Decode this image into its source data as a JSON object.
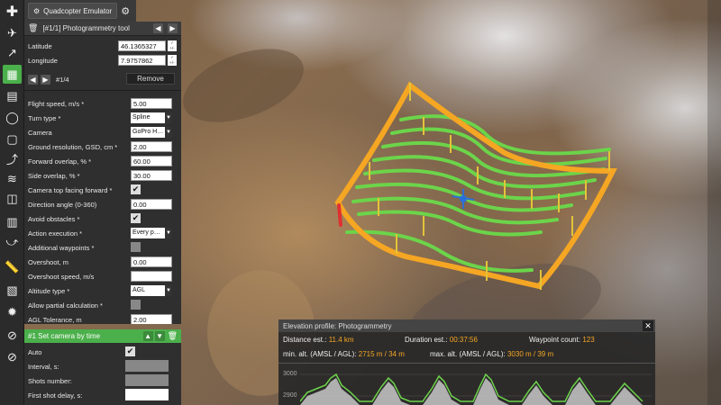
{
  "emulator": {
    "label": "Quadcopter Emulator"
  },
  "panel": {
    "title": "[#1/1] Photogrammetry tool",
    "latitude_label": "Latitude",
    "latitude": "46.1365327",
    "longitude_label": "Longitude",
    "longitude": "7.9757862",
    "nav_label": "#1/4",
    "remove_label": "Remove",
    "fields": [
      {
        "label": "Flight speed, m/s *",
        "value": "5.00"
      },
      {
        "label": "Turn type *",
        "value": "Spline"
      },
      {
        "label": "Camera",
        "value": "GoPro H…"
      },
      {
        "label": "Ground resolution, GSD, cm *",
        "value": "2.00"
      },
      {
        "label": "Forward overlap, % *",
        "value": "60.00"
      },
      {
        "label": "Side overlap, % *",
        "value": "30.00"
      },
      {
        "label": "Camera top facing forward *",
        "value": "✔"
      },
      {
        "label": "Direction angle (0-360)",
        "value": "0.00"
      },
      {
        "label": "Avoid obstacles *",
        "value": "✔"
      },
      {
        "label": "Action execution *",
        "value": "Every p…"
      },
      {
        "label": "Additional waypoints *",
        "value": ""
      },
      {
        "label": "Overshoot, m",
        "value": "0.00"
      },
      {
        "label": "Overshoot speed, m/s",
        "value": ""
      },
      {
        "label": "Altitude type *",
        "value": "AGL"
      },
      {
        "label": "Allow partial calculation *",
        "value": ""
      },
      {
        "label": "AGL Tolerance, m",
        "value": "2.00"
      }
    ]
  },
  "action": {
    "title": "#1 Set camera by time",
    "auto_label": "Auto",
    "auto_value": "✔",
    "interval_label": "Interval, s:",
    "shots_label": "Shots number:",
    "delay_label": "First shot delay, s:"
  },
  "elevation": {
    "title": "Elevation profile: Photogrammetry",
    "distance_label": "Distance est.:",
    "distance": "11.4 km",
    "duration_label": "Duration est.:",
    "duration": "00:37:56",
    "wp_label": "Waypoint count:",
    "wp": "123",
    "min_label": "min. alt. (AMSL / AGL):",
    "min": "2715 m / 34 m",
    "max_label": "max. alt. (AMSL / AGL):",
    "max": "3030 m / 39 m",
    "tick_3000": "3000",
    "tick_2900": "2900"
  },
  "colors": {
    "accent": "#4bb04b",
    "route_main": "#f5a623",
    "route_grid": "#6cd44a",
    "value_text": "#f5a623"
  }
}
